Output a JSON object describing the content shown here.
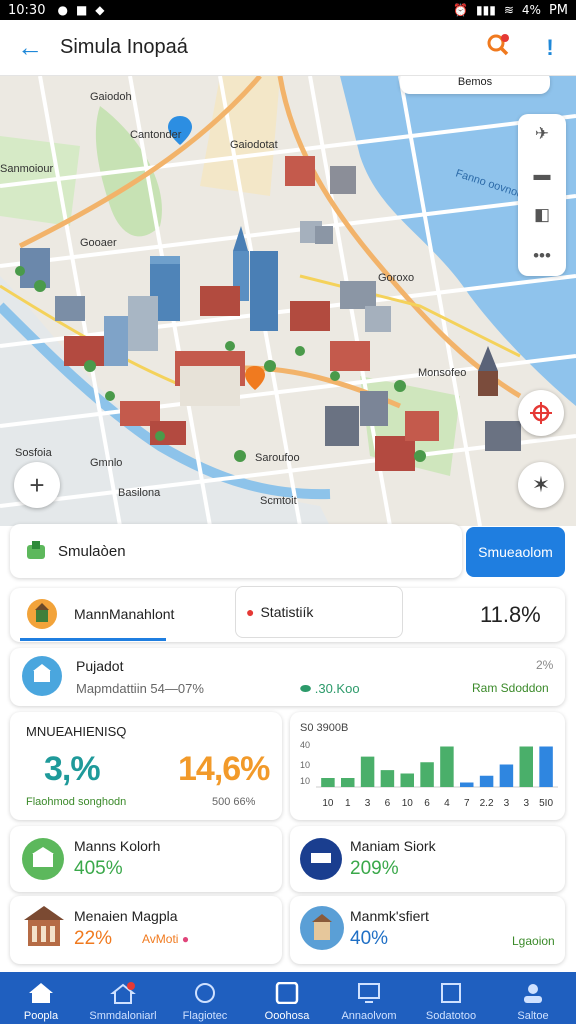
{
  "status": {
    "time": "10:30",
    "battery": "4%",
    "clock": "PM"
  },
  "appbar": {
    "title": "Simula Inopaá"
  },
  "map": {
    "labels": [
      "Gaiodoh",
      "Cantonder",
      "Sanmoiour",
      "Gaiodotat",
      "Fanno oovnod",
      "Gooaer",
      "Goroxo",
      "Monsofeo",
      "Sosfoia",
      "Gmnlo",
      "Saroufoo",
      "Basilona",
      "Scmtoit"
    ],
    "layers_label": "Bemos"
  },
  "simulation": {
    "label": "Smulaòen",
    "button": "Smueaolom"
  },
  "tabs": {
    "management": "MannManahlont",
    "statistics": "Statistiík",
    "percent": "11.8%"
  },
  "project": {
    "title": "Pujadot",
    "subtitle": "Mapmdattiin 54—07%",
    "value": ".30.Koo",
    "value_label": "Ram Sdoddon",
    "pct": "2%"
  },
  "kpi": {
    "header": "MNUEAHIENISQ",
    "value1": "3,%",
    "value2": "14,6%",
    "footer_left": "Flaohmod songhodn",
    "footer_right": "500 66%"
  },
  "bar_chart": {
    "title": "S0 3900B",
    "y_ticks": [
      "40",
      "10",
      "10"
    ],
    "x_labels": [
      "10",
      "1",
      "3",
      "6",
      "10",
      "6",
      "4",
      "7",
      "2.2",
      "3",
      "3",
      "5I0"
    ]
  },
  "chart_data": {
    "type": "bar",
    "categories": [
      "10",
      "1",
      "3",
      "6",
      "10",
      "6",
      "4",
      "7",
      "2.2",
      "3",
      "3",
      "5I0"
    ],
    "series": [
      {
        "values": [
          8,
          8,
          27,
          15,
          12,
          22,
          36,
          4,
          10,
          20,
          36,
          36
        ]
      }
    ],
    "colors": [
      "#4aaf6a",
      "#4aaf6a",
      "#4aaf6a",
      "#4aaf6a",
      "#4aaf6a",
      "#4aaf6a",
      "#4aaf6a",
      "#2f86e0",
      "#2f86e0",
      "#2f86e0",
      "#4aaf6a",
      "#2f86e0"
    ],
    "ylim": [
      0,
      40
    ]
  },
  "stats": [
    {
      "title": "Manns Kolorh",
      "value": "405%",
      "color": "#3aa84a"
    },
    {
      "title": "Maniam Siork",
      "value": "209%",
      "color": "#3aa84a"
    },
    {
      "title": "Menaien Magpla",
      "value": "22%",
      "tag": "AvMoti",
      "color": "#f07a1f"
    },
    {
      "title": "Manmk'sfiert",
      "value": "40%",
      "note": "Lgaoion",
      "color": "#1f6fc5"
    }
  ],
  "nav": [
    {
      "label": "Poopla"
    },
    {
      "label": "Smmdaloniarl"
    },
    {
      "label": "Flagiotec"
    },
    {
      "label": "Ooohosa"
    },
    {
      "label": "Annaolvom"
    },
    {
      "label": "Sodatotoo"
    },
    {
      "label": "Saltoe"
    }
  ],
  "accent": "#1f7ee0"
}
